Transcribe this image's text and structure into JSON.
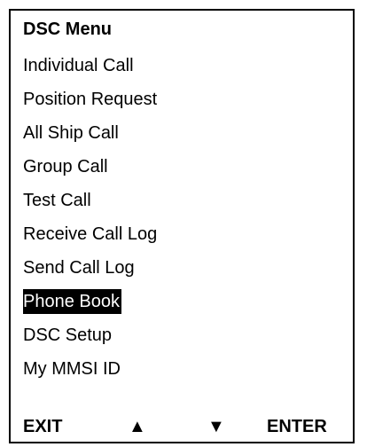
{
  "menu": {
    "title": "DSC Menu",
    "items": [
      {
        "label": "Individual Call",
        "selected": false
      },
      {
        "label": "Position Request",
        "selected": false
      },
      {
        "label": "All Ship Call",
        "selected": false
      },
      {
        "label": "Group Call",
        "selected": false
      },
      {
        "label": "Test Call",
        "selected": false
      },
      {
        "label": "Receive Call Log",
        "selected": false
      },
      {
        "label": "Send Call Log",
        "selected": false
      },
      {
        "label": "Phone Book",
        "selected": true
      },
      {
        "label": "DSC Setup",
        "selected": false
      },
      {
        "label": "My MMSI ID",
        "selected": false
      }
    ]
  },
  "softkeys": {
    "exit": "EXIT",
    "up": "▲",
    "down": "▼",
    "enter": "ENTER"
  }
}
